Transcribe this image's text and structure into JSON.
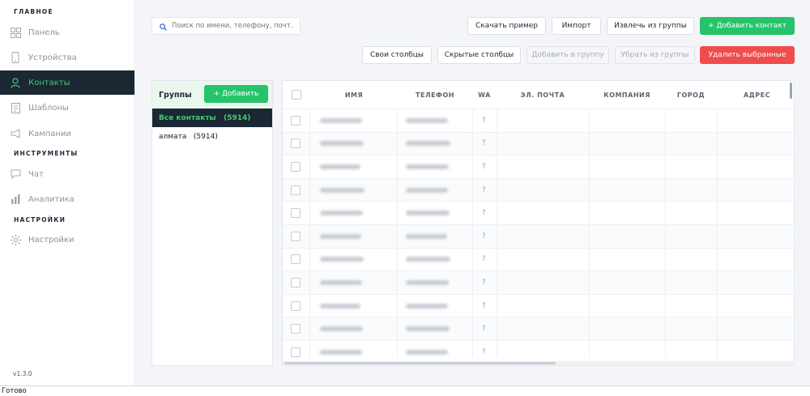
{
  "sidebar": {
    "sections": [
      {
        "title": "ГЛАВНОЕ"
      },
      {
        "title": "ИНСТРУМЕНТЫ"
      },
      {
        "title": "НАСТРОЙКИ"
      }
    ],
    "items": [
      {
        "label": "Панель",
        "icon": "dashboard-icon"
      },
      {
        "label": "Устройства",
        "icon": "phone-icon"
      },
      {
        "label": "Контакты",
        "icon": "user-icon",
        "active": true
      },
      {
        "label": "Шаблоны",
        "icon": "document-icon"
      },
      {
        "label": "Кампании",
        "icon": "megaphone-icon"
      },
      {
        "label": "Чат",
        "icon": "chat-icon"
      },
      {
        "label": "Аналитика",
        "icon": "chart-icon"
      },
      {
        "label": "Настройки",
        "icon": "gear-icon"
      }
    ],
    "version": "v1.3.0"
  },
  "toolbar": {
    "search_placeholder": "Поиск по имени, телефону, почт...",
    "download_sample": "Скачать пример",
    "import": "Импорт",
    "extract_from_group": "Извлечь из группы",
    "add_contact": "+ Добавить контакт",
    "own_columns": "Свои столбцы",
    "hidden_columns": "Скрытые столбцы",
    "add_to_group": "Добавить в группу",
    "remove_from_group": "Убрать из группы",
    "delete_selected": "Удалить выбранные"
  },
  "groups": {
    "title": "Группы",
    "add_label": "+ Добавить",
    "items": [
      {
        "label": "Все контакты   (5914)",
        "active": true
      },
      {
        "label": "алмата   (5914)",
        "active": false
      }
    ]
  },
  "table": {
    "columns": [
      "ИМЯ",
      "ТЕЛЕФОН",
      "WA",
      "ЭЛ. ПОЧТА",
      "КОМПАНИЯ",
      "ГОРОД",
      "АДРЕС"
    ],
    "wa_status": "?",
    "row_count": 11
  },
  "colors": {
    "accent_green": "#27c36a",
    "danger_red": "#ef4d4d",
    "sidebar_active_bg": "#1b2733"
  },
  "statusbar": {
    "text": "Готово"
  }
}
